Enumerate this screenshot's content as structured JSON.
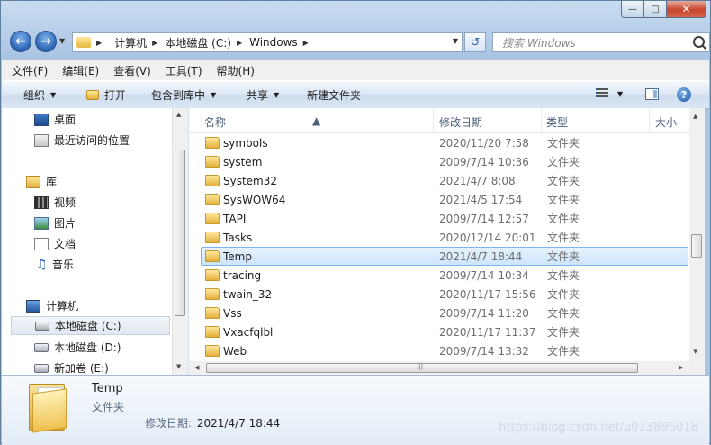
{
  "window": {
    "minimize_glyph": "—",
    "maximize_glyph": "□",
    "close_glyph": "✕"
  },
  "address": {
    "breadcrumbs": [
      "计算机",
      "本地磁盘 (C:)",
      "Windows"
    ]
  },
  "search": {
    "placeholder": "搜索 Windows"
  },
  "menu": [
    "文件(F)",
    "编辑(E)",
    "查看(V)",
    "工具(T)",
    "帮助(H)"
  ],
  "toolbar": {
    "organize": "组织",
    "open": "打开",
    "include_in_library": "包含到库中",
    "share": "共享",
    "new_folder": "新建文件夹"
  },
  "nav": {
    "desktop": "桌面",
    "recent": "最近访问的位置",
    "libraries": "库",
    "videos": "视频",
    "pictures": "图片",
    "documents": "文档",
    "music": "音乐",
    "computer": "计算机",
    "drive_c": "本地磁盘 (C:)",
    "drive_d": "本地磁盘 (D:)",
    "drive_e": "新加卷 (E:)"
  },
  "columns": {
    "name": "名称",
    "modified": "修改日期",
    "type": "类型",
    "size": "大小"
  },
  "files": [
    {
      "name": "symbols",
      "date": "2020/11/20 7:58",
      "type": "文件夹"
    },
    {
      "name": "system",
      "date": "2009/7/14 10:36",
      "type": "文件夹"
    },
    {
      "name": "System32",
      "date": "2021/4/7 8:08",
      "type": "文件夹"
    },
    {
      "name": "SysWOW64",
      "date": "2021/4/5 17:54",
      "type": "文件夹"
    },
    {
      "name": "TAPI",
      "date": "2009/7/14 12:57",
      "type": "文件夹"
    },
    {
      "name": "Tasks",
      "date": "2020/12/14 20:01",
      "type": "文件夹"
    },
    {
      "name": "Temp",
      "date": "2021/4/7 18:44",
      "type": "文件夹"
    },
    {
      "name": "tracing",
      "date": "2009/7/14 10:34",
      "type": "文件夹"
    },
    {
      "name": "twain_32",
      "date": "2020/11/17 15:56",
      "type": "文件夹"
    },
    {
      "name": "Vss",
      "date": "2009/7/14 11:20",
      "type": "文件夹"
    },
    {
      "name": "Vxacfqlbl",
      "date": "2020/11/17 11:37",
      "type": "文件夹"
    },
    {
      "name": "Web",
      "date": "2009/7/14 13:32",
      "type": "文件夹"
    }
  ],
  "selected_index": 6,
  "details": {
    "name": "Temp",
    "type": "文件夹",
    "modified_label": "修改日期:",
    "modified_value": "2021/4/7 18:44"
  },
  "watermark": "https://blog.csdn.net/u013896018"
}
